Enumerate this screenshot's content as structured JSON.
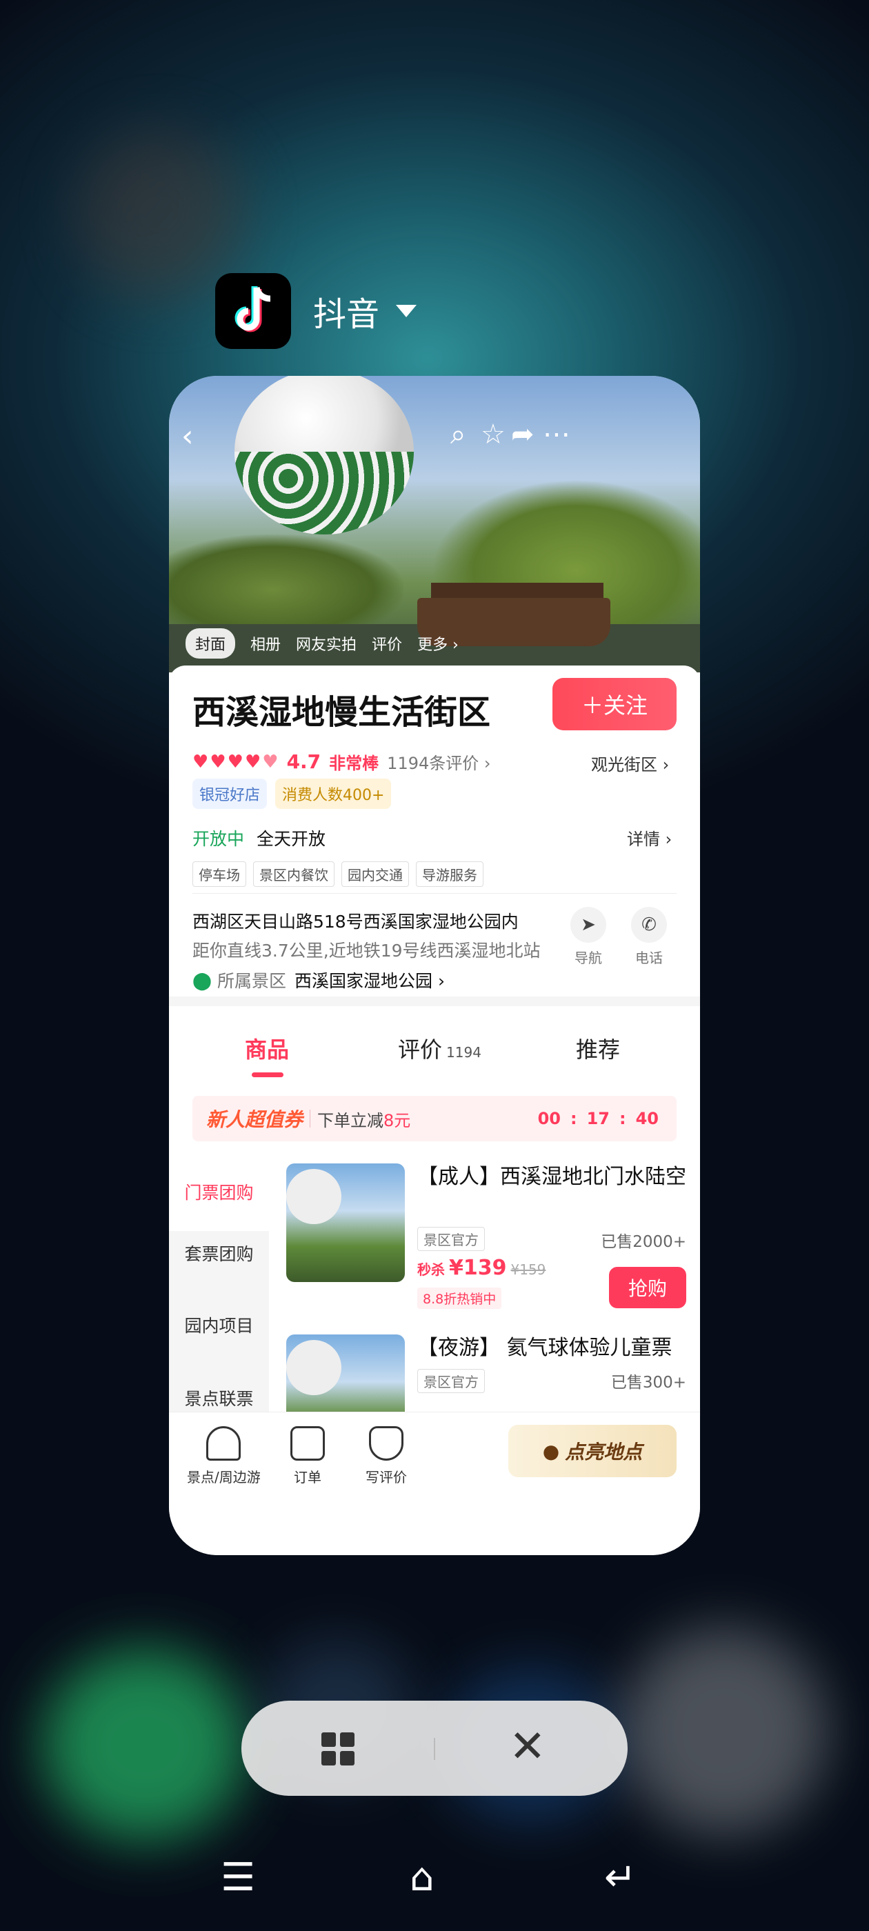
{
  "app": {
    "name": "抖音"
  },
  "hero": {
    "tabs": [
      "封面",
      "相册",
      "网友实拍",
      "评价",
      "更多 ›"
    ]
  },
  "info": {
    "title": "西溪湿地慢生活街区",
    "follow_label": "＋关注",
    "score": "4.7",
    "score_text": "非常棒",
    "review_count": "1194条评价 ›",
    "type_link": "观光街区 ›",
    "badges": [
      "银冠好店",
      "消费人数400+"
    ],
    "open_status": "开放中",
    "open_hours": "全天开放",
    "detail_link": "详情 ›",
    "facilities": [
      "停车场",
      "景区内餐饮",
      "园内交通",
      "导游服务"
    ],
    "address": "西湖区天目山路518号西溪国家湿地公园内",
    "distance": "距你直线3.7公里,近地铁19号线西溪湿地北站",
    "parent_label": "所属景区",
    "parent_value": "西溪国家湿地公园 ›",
    "quick": [
      "导航",
      "电话"
    ]
  },
  "tabs": [
    {
      "label": "商品"
    },
    {
      "label": "评价",
      "count": "1194"
    },
    {
      "label": "推荐"
    }
  ],
  "coupon": {
    "tag": "新人超值券",
    "text": "下单立减",
    "amount": "8元",
    "timer": [
      "00",
      "17",
      "40"
    ]
  },
  "side_nav": [
    "门票团购",
    "套票团购",
    "园内项目",
    "景点联票"
  ],
  "products": [
    {
      "title": "【成人】西溪湿地北门水陆空",
      "tag": "景区官方",
      "sold": "已售2000+",
      "seckill": "秒杀",
      "price": "¥139",
      "orig": "¥159",
      "discount": "8.8折热销中",
      "buy": "抢购"
    },
    {
      "title": "【夜游】 氦气球体验儿童票",
      "tag": "景区官方",
      "sold": "已售300+"
    }
  ],
  "bottom_bar": {
    "items": [
      "景点/周边游",
      "订单",
      "写评价"
    ],
    "light_label": "点亮地点"
  }
}
